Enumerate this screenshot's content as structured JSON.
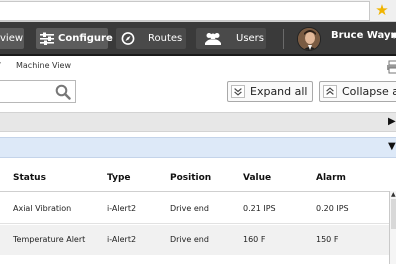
{
  "nav": {
    "view_label": "view",
    "configure_label": "Configure",
    "routes_label": "Routes",
    "users_label": "Users",
    "user_name": "Bruce Wayne"
  },
  "breadcrumb": {
    "separator": "/",
    "current": "Machine View"
  },
  "search": {
    "value": "",
    "placeholder": ""
  },
  "toolbar": {
    "expand_label": "Expand all",
    "collapse_label": "Collapse a"
  },
  "table": {
    "headers": [
      "Status",
      "Type",
      "Position",
      "Value",
      "Alarm"
    ],
    "rows": [
      [
        "Axial Vibration",
        "i-Alert2",
        "Drive end",
        "0.21 IPS",
        "0.20 IPS"
      ],
      [
        "Temperature Alert",
        "i-Alert2",
        "Drive end",
        "160 F",
        "150 F"
      ]
    ]
  },
  "colors": {
    "nav_bg": "#3a3a3a",
    "expanded_section_bg": "#dde9f8",
    "collapsed_section_bg": "#e7e7e7"
  }
}
